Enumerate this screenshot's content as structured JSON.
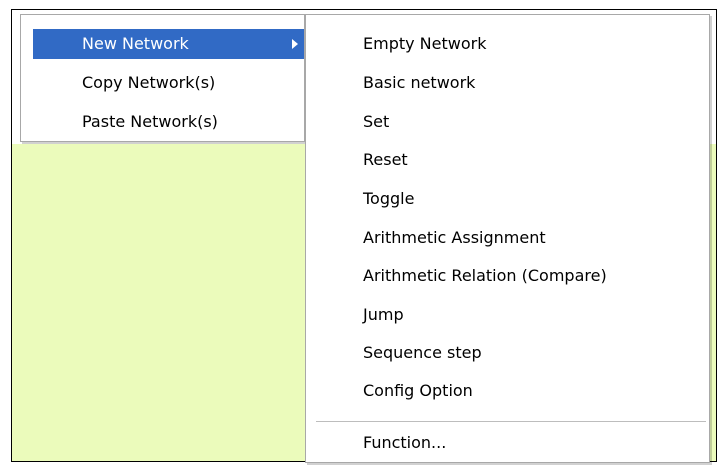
{
  "context_menu": {
    "items": [
      {
        "label": "New Network",
        "has_submenu": true,
        "selected": true
      },
      {
        "label": "Copy Network(s)",
        "has_submenu": false,
        "selected": false
      },
      {
        "label": "Paste Network(s)",
        "has_submenu": false,
        "selected": false
      }
    ]
  },
  "submenu": {
    "items": [
      {
        "label": "Empty Network"
      },
      {
        "label": "Basic network"
      },
      {
        "label": "Set"
      },
      {
        "label": "Reset"
      },
      {
        "label": "Toggle"
      },
      {
        "label": "Arithmetic Assignment"
      },
      {
        "label": "Arithmetic Relation (Compare)"
      },
      {
        "label": "Jump"
      },
      {
        "label": "Sequence step"
      },
      {
        "label": "Config Option"
      },
      {
        "label": "Function..."
      }
    ]
  },
  "colors": {
    "workspace_background": "#ebfbbb",
    "selection_background": "#316ac5",
    "selection_text": "#ffffff"
  },
  "icons": {
    "submenu_arrow": "chevron-right-icon"
  }
}
